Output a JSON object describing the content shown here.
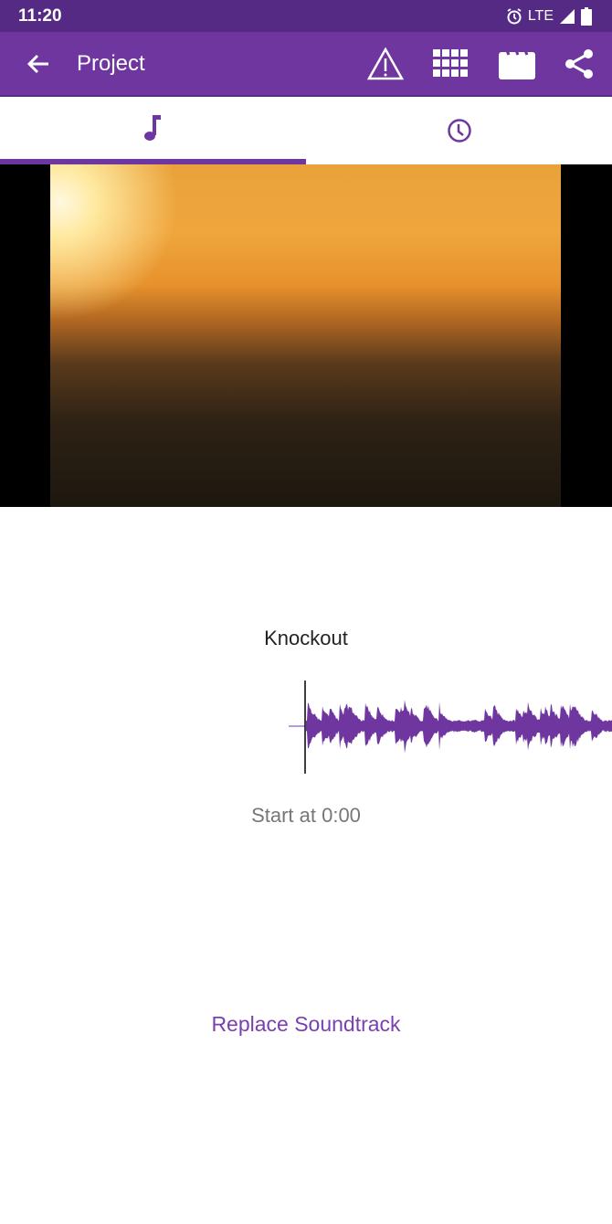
{
  "status_bar": {
    "time": "11:20",
    "network": "LTE",
    "icons": [
      "alarm-icon",
      "signal-icon",
      "battery-icon"
    ]
  },
  "app_bar": {
    "title": "Project",
    "icons": [
      "back-arrow-icon",
      "warning-icon",
      "grid-icon",
      "clapperboard-icon",
      "share-icon"
    ]
  },
  "tabs": [
    {
      "icon": "music-note-icon",
      "active": true
    },
    {
      "icon": "clock-icon",
      "active": false
    }
  ],
  "soundtrack": {
    "name": "Knockout",
    "start_label": "Start at 0:00",
    "replace_label": "Replace Soundtrack"
  },
  "colors": {
    "accent": "#6f36a0",
    "status_bar": "#552a85"
  }
}
